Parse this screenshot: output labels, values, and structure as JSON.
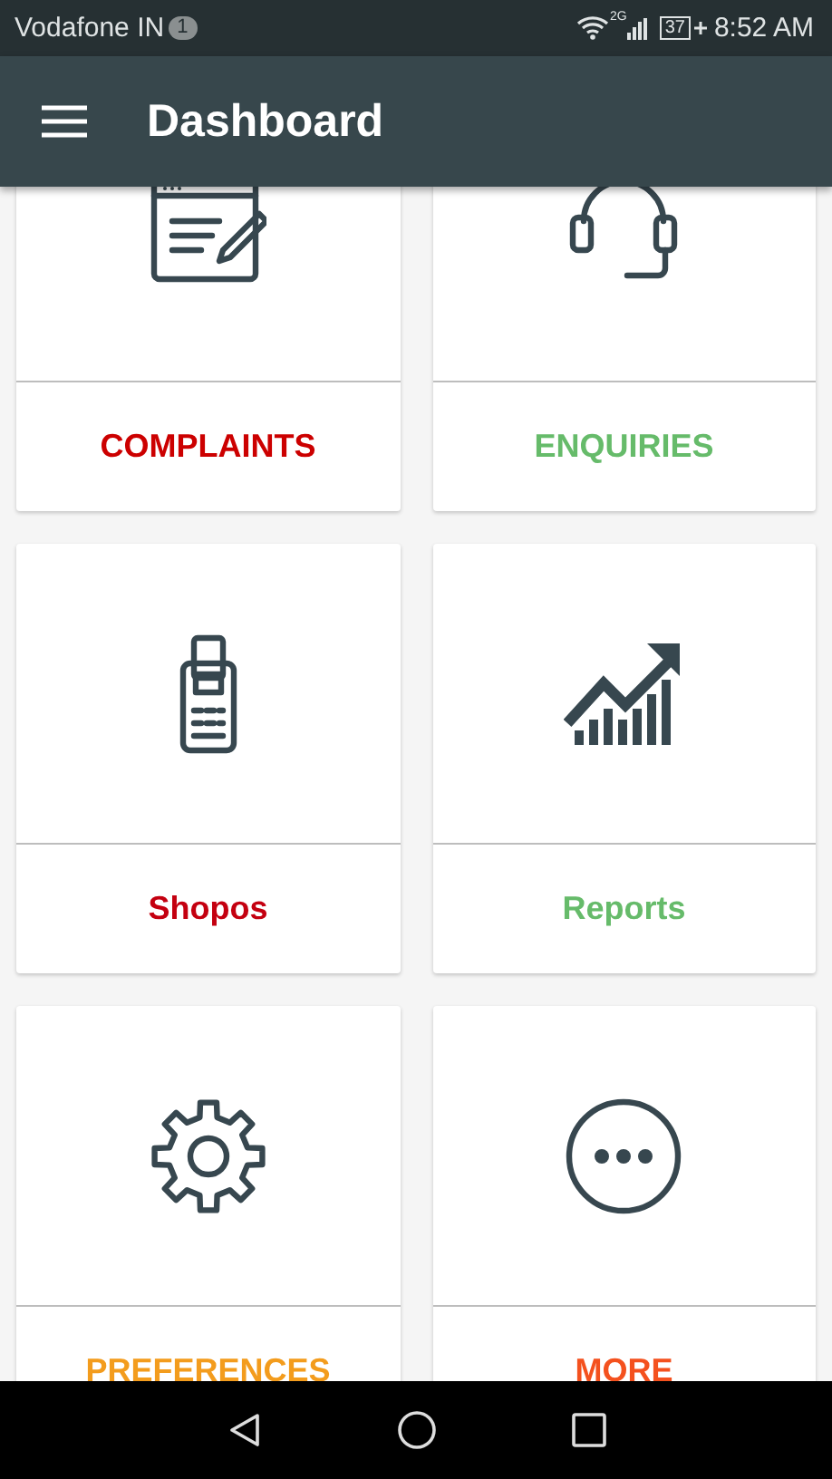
{
  "status_bar": {
    "carrier": "Vodafone IN",
    "notification_count": "1",
    "network": "2G",
    "battery": "37",
    "time": "8:52 AM"
  },
  "app_bar": {
    "title": "Dashboard"
  },
  "tiles": [
    {
      "label": "COMPLAINTS",
      "color": "#cc0000"
    },
    {
      "label": "ENQUIRIES",
      "color": "#66bb6a"
    },
    {
      "label": "Shopos",
      "color": "#c40010"
    },
    {
      "label": "Reports",
      "color": "#66bb6a"
    },
    {
      "label": "PREFERENCES",
      "color": "#f39c1d"
    },
    {
      "label": "MORE",
      "color": "#f4511e"
    }
  ]
}
